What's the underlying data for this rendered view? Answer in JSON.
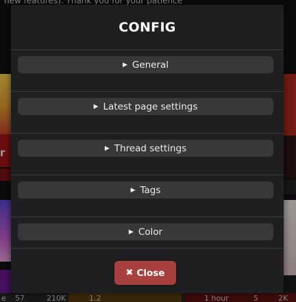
{
  "background": {
    "notice_text": "new features). Thank you for your patience",
    "left_card_title_fragment": "r C",
    "bottom_stats": {
      "left": [
        "e",
        "57",
        "210K",
        "1.2"
      ],
      "right": [
        "1 hour",
        "5",
        "2K"
      ]
    }
  },
  "modal": {
    "title": "CONFIG",
    "sections": [
      {
        "label": "General",
        "icon": "triangle-right-icon"
      },
      {
        "label": "Latest page settings",
        "icon": "triangle-right-icon"
      },
      {
        "label": "Thread settings",
        "icon": "triangle-right-icon"
      },
      {
        "label": "Tags",
        "icon": "triangle-right-icon"
      },
      {
        "label": "Color",
        "icon": "triangle-right-icon"
      }
    ],
    "close_label": "Close",
    "close_icon": "close-icon",
    "colors": {
      "modal_bg": "#1f1f22",
      "section_bg": "#38383b",
      "divider": "#3a3a3d",
      "close_bg": "#a7403e"
    }
  }
}
